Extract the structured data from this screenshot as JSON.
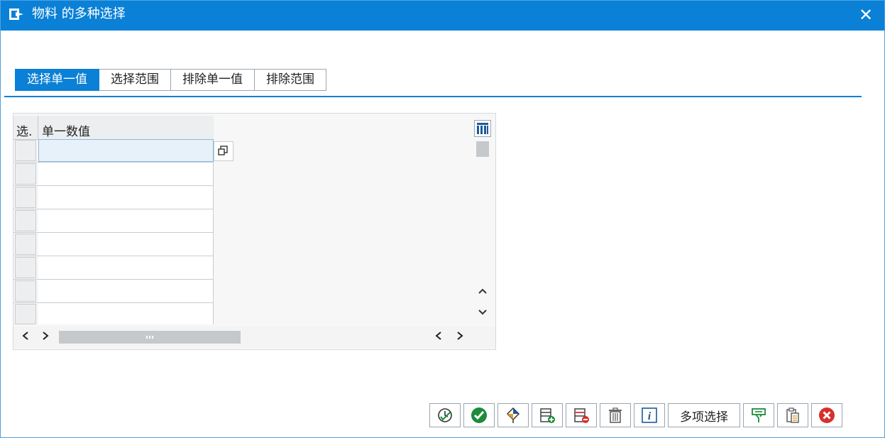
{
  "window": {
    "title": "物料 的多种选择",
    "close_glyph": "✕"
  },
  "tabs": [
    {
      "label": "选择单一值",
      "active": true
    },
    {
      "label": "选择范围",
      "active": false
    },
    {
      "label": "排除单一值",
      "active": false
    },
    {
      "label": "排除范围",
      "active": false
    }
  ],
  "grid": {
    "col_select": "选.",
    "col_value": "单一数值",
    "rows": [
      "",
      "",
      "",
      "",
      "",
      "",
      "",
      ""
    ]
  },
  "toolbar": {
    "multi_select_label": "多项选择",
    "icons": [
      "check-entries-icon",
      "ok-check-icon",
      "program-icon",
      "add-row-icon",
      "delete-row-icon",
      "trash-icon",
      "info-icon",
      "filter-icon",
      "paste-clipboard-icon",
      "cancel-icon"
    ]
  },
  "colors": {
    "accent": "#0a80d6",
    "ok": "#1a8c3a",
    "cancel": "#d6312b"
  }
}
